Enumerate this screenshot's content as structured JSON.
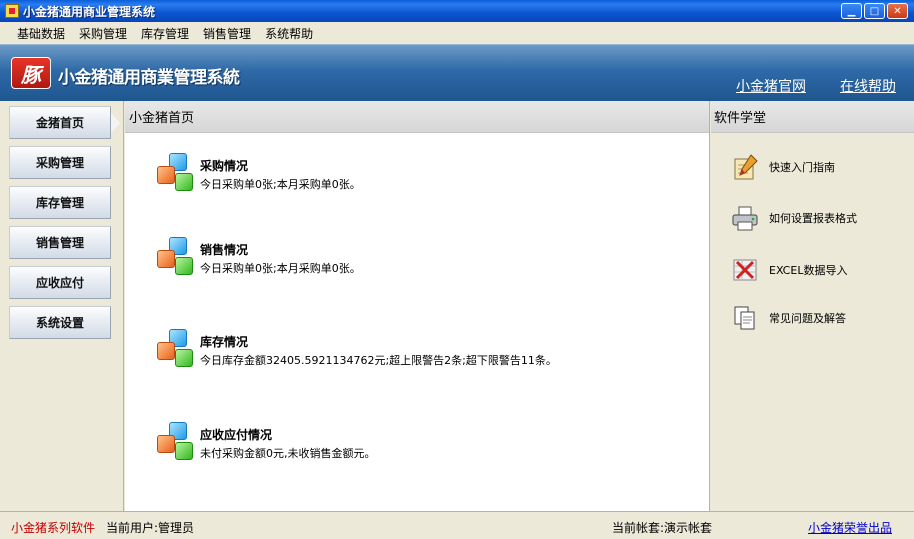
{
  "window": {
    "title": "小金猪通用商业管理系统",
    "min_label": "▁",
    "max_label": "□",
    "close_label": "✕"
  },
  "menu": [
    "基础数据",
    "采购管理",
    "库存管理",
    "销售管理",
    "系统帮助"
  ],
  "banner": {
    "logo_text": "豚",
    "title": "小金猪通用商業管理系統",
    "link_official": "小金猪官网",
    "link_help": "在线帮助"
  },
  "nav": [
    "金猪首页",
    "采购管理",
    "库存管理",
    "销售管理",
    "应收应付",
    "系统设置"
  ],
  "main": {
    "title": "小金猪首页",
    "items": [
      {
        "title": "采购情况",
        "desc": "今日采购单0张;本月采购单0张。"
      },
      {
        "title": "销售情况",
        "desc": "今日采购单0张;本月采购单0张。"
      },
      {
        "title": "库存情况",
        "desc": "今日库存金额32405.5921134762元;超上限警告2条;超下限警告11条。"
      },
      {
        "title": "应收应付情况",
        "desc": "未付采购金额0元,未收销售金额元。"
      }
    ]
  },
  "side": {
    "title": "软件学堂",
    "items": [
      {
        "label": "快速入门指南",
        "icon": "pencil-notepad-icon"
      },
      {
        "label": "如何设置报表格式",
        "icon": "printer-icon"
      },
      {
        "label": "EXCEL数据导入",
        "icon": "excel-icon"
      },
      {
        "label": "常见问题及解答",
        "icon": "documents-icon"
      }
    ]
  },
  "status": {
    "brand": "小金猪系列软件",
    "user": "当前用户:管理员",
    "account": "当前帐套:演示帐套",
    "link": "小金猪荣誉出品"
  },
  "colors": {
    "brand_red": "#c00000",
    "banner_blue": "#2f6aa8",
    "link_blue": "#0000cc"
  }
}
